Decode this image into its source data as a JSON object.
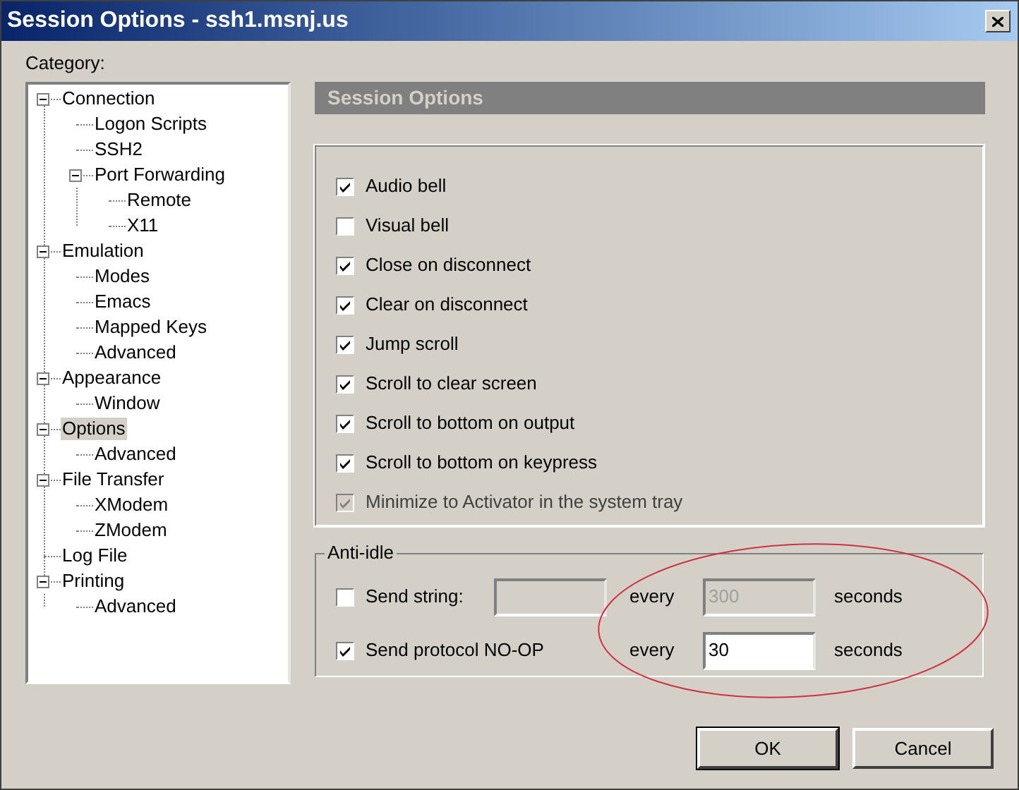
{
  "window": {
    "title": "Session Options - ssh1.msnj.us"
  },
  "category_label": "Category:",
  "tree": [
    {
      "label": "Connection",
      "expanded": true,
      "selected": false,
      "children": [
        {
          "label": "Logon Scripts",
          "selected": false
        },
        {
          "label": "SSH2",
          "selected": false
        },
        {
          "label": "Port Forwarding",
          "expanded": true,
          "selected": false,
          "children": [
            {
              "label": "Remote",
              "selected": false
            },
            {
              "label": "X11",
              "selected": false
            }
          ]
        }
      ]
    },
    {
      "label": "Emulation",
      "expanded": true,
      "selected": false,
      "children": [
        {
          "label": "Modes",
          "selected": false
        },
        {
          "label": "Emacs",
          "selected": false
        },
        {
          "label": "Mapped Keys",
          "selected": false
        },
        {
          "label": "Advanced",
          "selected": false
        }
      ]
    },
    {
      "label": "Appearance",
      "expanded": true,
      "selected": false,
      "children": [
        {
          "label": "Window",
          "selected": false
        }
      ]
    },
    {
      "label": "Options",
      "expanded": true,
      "selected": true,
      "children": [
        {
          "label": "Advanced",
          "selected": false
        }
      ]
    },
    {
      "label": "File Transfer",
      "expanded": true,
      "selected": false,
      "children": [
        {
          "label": "XModem",
          "selected": false
        },
        {
          "label": "ZModem",
          "selected": false
        }
      ]
    },
    {
      "label": "Log File",
      "selected": false
    },
    {
      "label": "Printing",
      "expanded": true,
      "selected": false,
      "children": [
        {
          "label": "Advanced",
          "selected": false
        }
      ]
    }
  ],
  "panel_title": "Session Options",
  "options": [
    {
      "label": "Audio bell",
      "checked": true,
      "disabled": false
    },
    {
      "label": "Visual bell",
      "checked": false,
      "disabled": false
    },
    {
      "label": "Close on disconnect",
      "checked": true,
      "disabled": false
    },
    {
      "label": "Clear on disconnect",
      "checked": true,
      "disabled": false
    },
    {
      "label": "Jump scroll",
      "checked": true,
      "disabled": false
    },
    {
      "label": "Scroll to clear screen",
      "checked": true,
      "disabled": false
    },
    {
      "label": "Scroll to bottom on output",
      "checked": true,
      "disabled": false
    },
    {
      "label": "Scroll to bottom on keypress",
      "checked": true,
      "disabled": false
    },
    {
      "label": "Minimize to Activator in the system tray",
      "checked": true,
      "disabled": true
    }
  ],
  "anti_idle": {
    "title": "Anti-idle",
    "rows": [
      {
        "label": "Send string:",
        "checked": false,
        "text_field": {
          "disabled": true
        },
        "every": "every",
        "interval": {
          "value": "300",
          "disabled": true
        },
        "unit": "seconds"
      },
      {
        "label": "Send protocol NO-OP",
        "checked": true,
        "every": "every",
        "interval": {
          "value": "30",
          "disabled": false
        },
        "unit": "seconds"
      }
    ]
  },
  "buttons": [
    {
      "label": "OK",
      "default": true
    },
    {
      "label": "Cancel",
      "default": false
    }
  ]
}
